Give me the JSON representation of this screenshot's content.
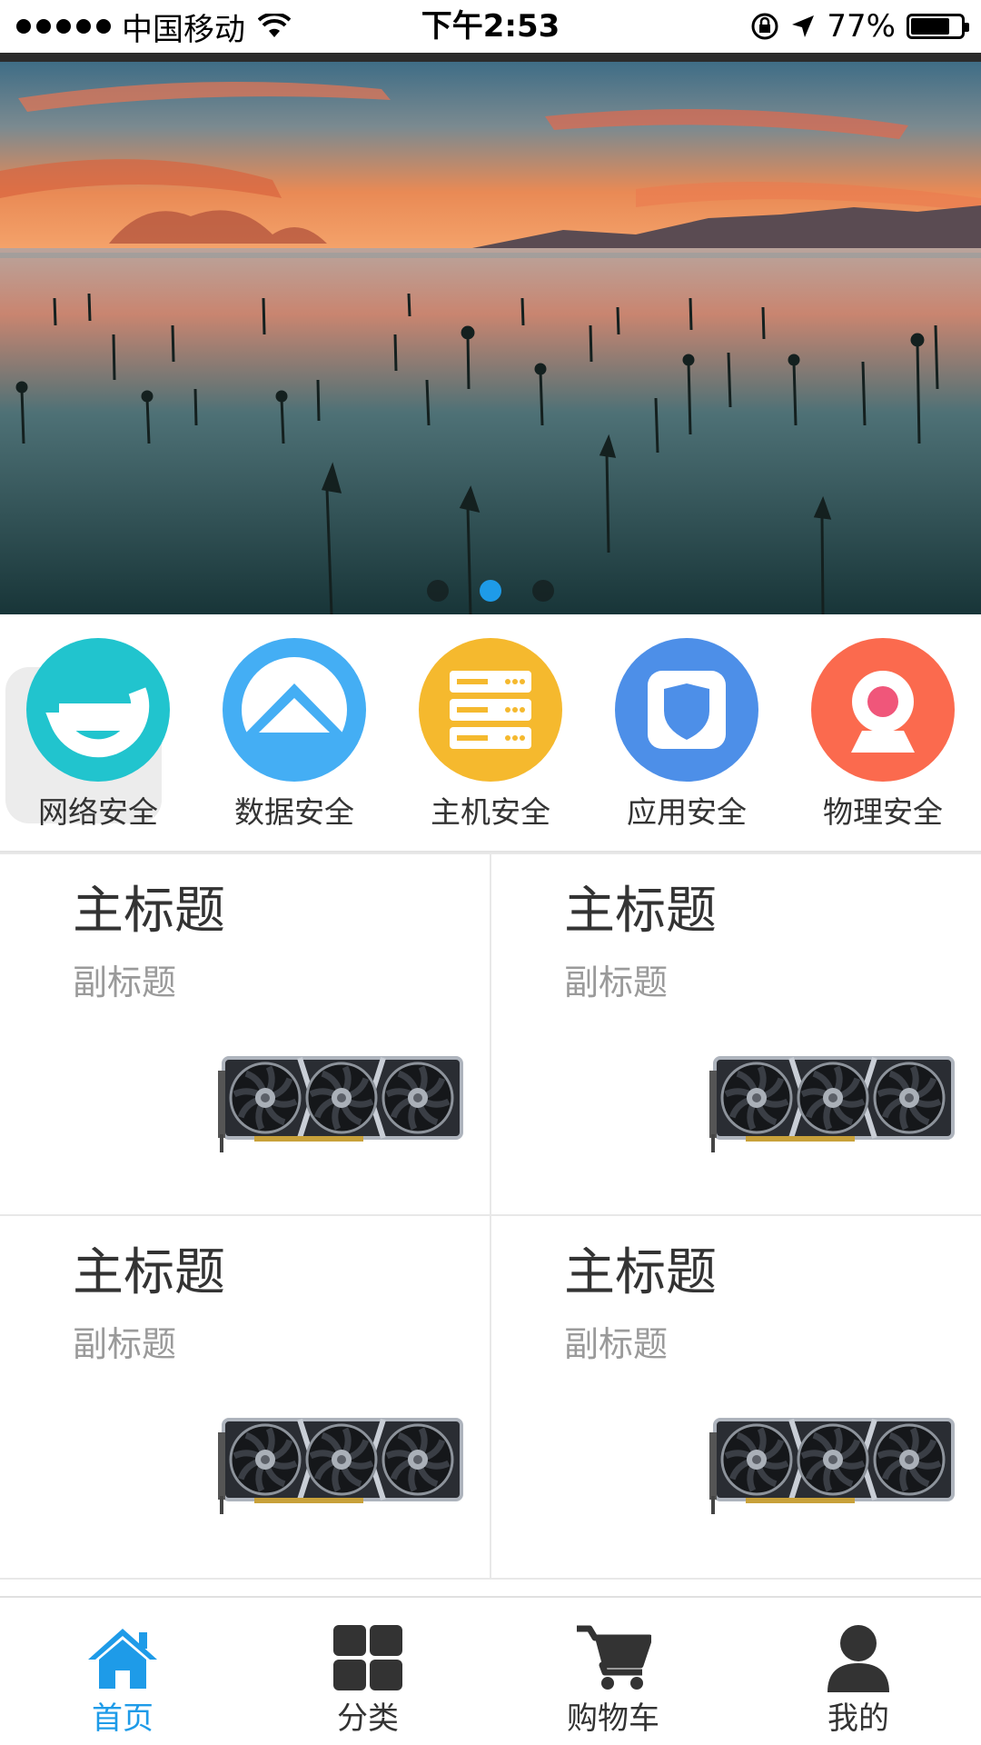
{
  "status_bar": {
    "carrier": "中国移动",
    "time": "下午2:53",
    "battery_text": "77%",
    "battery_level": 0.77,
    "icons": [
      "signal-dots-icon",
      "wifi-icon",
      "orientation-lock-icon",
      "location-arrow-icon",
      "battery-icon"
    ]
  },
  "banner": {
    "slides": 3,
    "active_index": 1,
    "indicator_active_color": "#1e9be8"
  },
  "categories": [
    {
      "label": "网络安全",
      "icon": "network-security-icon",
      "color": "#21c4ce"
    },
    {
      "label": "数据安全",
      "icon": "data-security-icon",
      "color": "#44aef4"
    },
    {
      "label": "主机安全",
      "icon": "server-security-icon",
      "color": "#f5b92e"
    },
    {
      "label": "应用安全",
      "icon": "app-security-icon",
      "color": "#4d8fe8"
    },
    {
      "label": "物理安全",
      "icon": "physical-security-icon",
      "color": "#fb6a4e"
    }
  ],
  "products": [
    {
      "title": "主标题",
      "subtitle": "副标题",
      "image": "graphics-card-image"
    },
    {
      "title": "主标题",
      "subtitle": "副标题",
      "image": "graphics-card-image"
    },
    {
      "title": "主标题",
      "subtitle": "副标题",
      "image": "graphics-card-image"
    },
    {
      "title": "主标题",
      "subtitle": "副标题",
      "image": "graphics-card-image"
    }
  ],
  "tabbar": {
    "active_color": "#1e9be8",
    "items": [
      {
        "label": "首页",
        "icon": "home-icon",
        "active": true
      },
      {
        "label": "分类",
        "icon": "grid-icon",
        "active": false
      },
      {
        "label": "购物车",
        "icon": "cart-icon",
        "active": false
      },
      {
        "label": "我的",
        "icon": "user-icon",
        "active": false
      }
    ]
  }
}
